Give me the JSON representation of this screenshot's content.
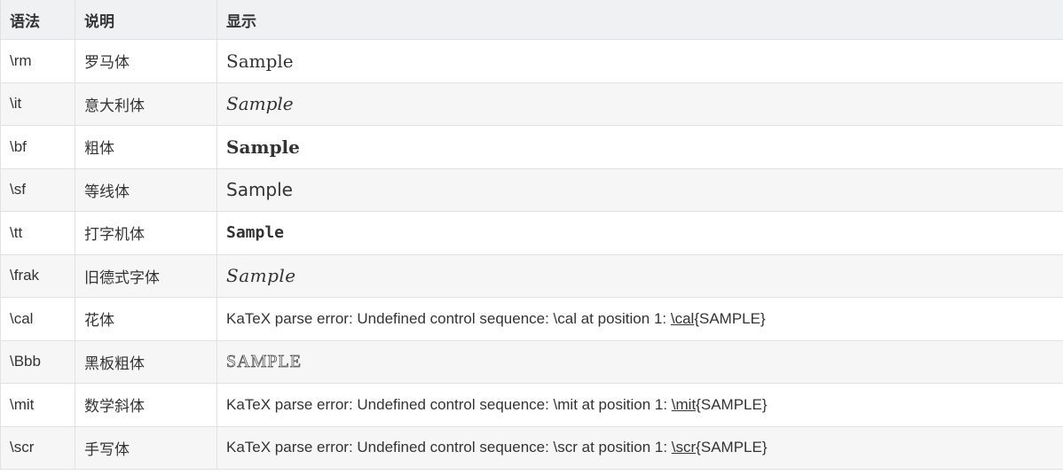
{
  "table": {
    "headers": [
      "语法",
      "说明",
      "显示"
    ],
    "rows": [
      {
        "syntax": "\\rm",
        "desc": "罗马体",
        "display": "Sample",
        "style": "rm"
      },
      {
        "syntax": "\\it",
        "desc": "意大利体",
        "display": "Sample",
        "style": "it"
      },
      {
        "syntax": "\\bf",
        "desc": "粗体",
        "display": "Sample",
        "style": "bf"
      },
      {
        "syntax": "\\sf",
        "desc": "等线体",
        "display": "Sample",
        "style": "sf"
      },
      {
        "syntax": "\\tt",
        "desc": "打字机体",
        "display": "Sample",
        "style": "tt"
      },
      {
        "syntax": "\\frak",
        "desc": "旧德式字体",
        "display": "Sample",
        "style": "frak"
      },
      {
        "syntax": "\\cal",
        "desc": "花体",
        "error_prefix": "KaTeX parse error: Undefined control sequence: \\cal at position 1: ",
        "error_cmd": "\\cal",
        "error_suffix": "{SAMPLE}",
        "style": "error"
      },
      {
        "syntax": "\\Bbb",
        "desc": "黑板粗体",
        "display": "SAMPLE",
        "style": "bbb"
      },
      {
        "syntax": "\\mit",
        "desc": "数学斜体",
        "error_prefix": "KaTeX parse error: Undefined control sequence: \\mit at position 1: ",
        "error_cmd": "\\mit",
        "error_suffix": "{SAMPLE}",
        "style": "error"
      },
      {
        "syntax": "\\scr",
        "desc": "手写体",
        "error_prefix": "KaTeX parse error: Undefined control sequence: \\scr at position 1: ",
        "error_cmd": "\\scr",
        "error_suffix": "{SAMPLE}",
        "style": "error"
      }
    ]
  }
}
